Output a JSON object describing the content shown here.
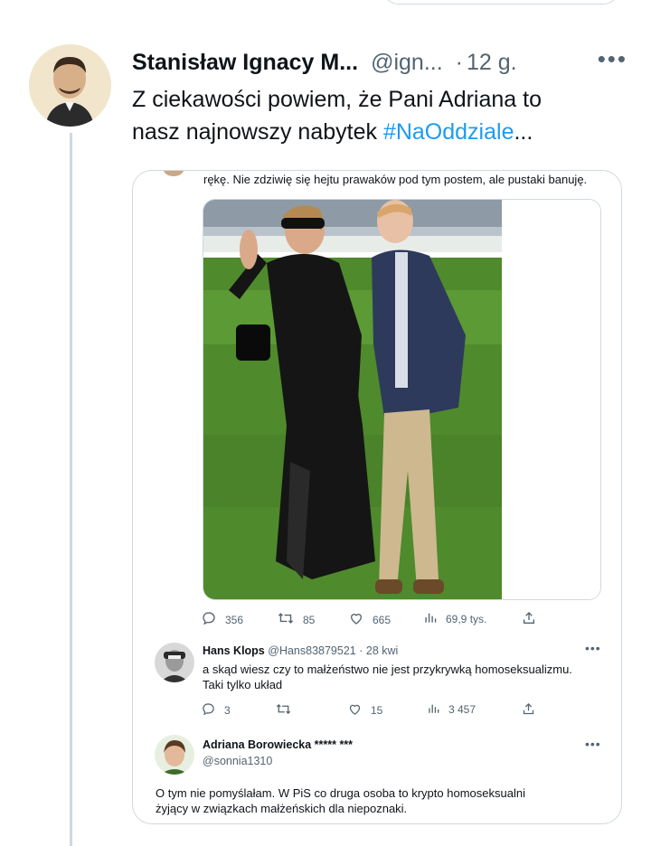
{
  "tweet": {
    "author_name": "Stanisław Ignacy M...",
    "author_handle": "@ign...",
    "separator": "·",
    "time": "12 g.",
    "more": "•••",
    "text_line1": "Z ciekawości powiem, że Pani Adriana to",
    "text_line2_prefix": "nasz najnowszy nabytek ",
    "hashtag": "#NaOddziale",
    "ellipsis": "..."
  },
  "quoted": {
    "partial_text": "rękę. Nie zdziwię się hejtu prawaków pod tym postem, ale pustaki banuję.",
    "stats": {
      "replies": "356",
      "retweets": "85",
      "likes": "665",
      "views": "69,9 tys."
    },
    "replies_list": [
      {
        "name": "Hans Klops",
        "handle": "@Hans83879521",
        "time": "· 28 kwi",
        "text_line1": "a skąd wiesz czy to małżeństwo nie jest przykrywką homoseksualizmu.",
        "text_line2": "Taki tylko układ",
        "replies": "3",
        "retweets": "",
        "likes": "15",
        "views": "3 457",
        "more": "•••"
      },
      {
        "name": "Adriana Borowiecka ***** ***",
        "handle": "@sonnia1310",
        "text_line1": "O tym nie pomyślałam. W PiS co druga osoba to krypto homoseksualni",
        "text_line2": "żyjący w związkach małżeńskich dla niepoznaki.",
        "more": "•••"
      }
    ]
  },
  "colors": {
    "accent": "#1d9bf0",
    "text": "#0f1419",
    "muted": "#536471",
    "border": "#cfd9de"
  },
  "icons": [
    "reply-icon",
    "retweet-icon",
    "like-icon",
    "views-icon",
    "share-icon",
    "more-icon"
  ]
}
